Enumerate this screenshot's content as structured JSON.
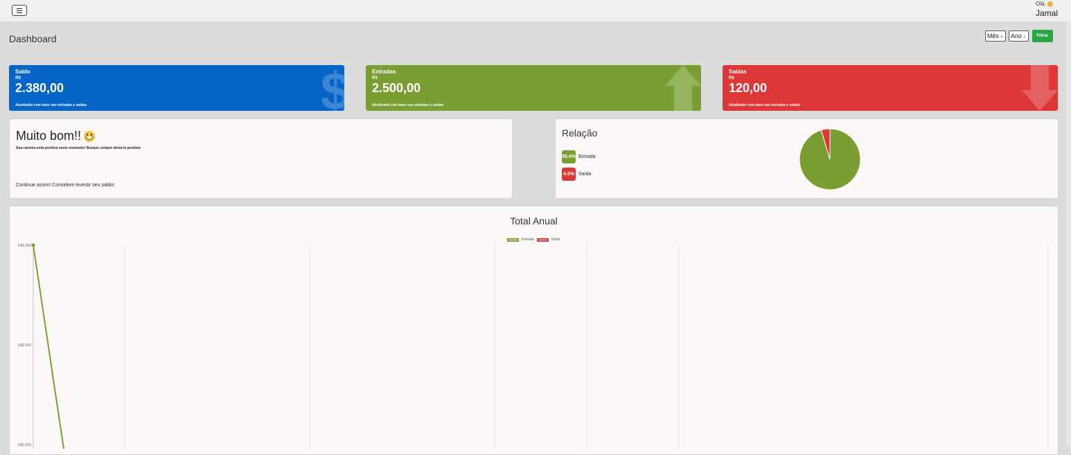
{
  "header": {
    "greeting": "Olá,",
    "user_name": "Jamal"
  },
  "page": {
    "title": "Dashboard"
  },
  "filters": {
    "month_label": "Mês",
    "year_label": "Ano",
    "filter_button": "Filtrar"
  },
  "stats": [
    {
      "label": "Saldo",
      "currency": "R$",
      "value": "2.380,00",
      "note": "Atualizado com base nas entradas e saídas",
      "color": "#0565c7",
      "icon": "dollar-icon"
    },
    {
      "label": "Entradas",
      "currency": "R$",
      "value": "2.500,00",
      "note": "Atualizado com base nas entradas e saídas",
      "color": "#7a9e31",
      "icon": "arrow-up-icon"
    },
    {
      "label": "Saídas",
      "currency": "R$",
      "value": "120,00",
      "note": "Atualizado com base nas entradas e saídas",
      "color": "#dd3737",
      "icon": "arrow-down-icon"
    }
  ],
  "message": {
    "title": "Muito bom!!",
    "subtitle": "Sua carteira está positiva neste momento! Busque sempre deixa-la positiva",
    "footer": "Continue assim! Considere investir seu saldo!"
  },
  "relation": {
    "title": "Relação",
    "items": [
      {
        "percent": "95.4%",
        "label": "Entrada",
        "color": "#7a9e31"
      },
      {
        "percent": "4.6%",
        "label": "Saída",
        "color": "#dd3737"
      }
    ]
  },
  "chart_data": [
    {
      "type": "pie",
      "title": "",
      "categories": [
        "Entrada",
        "Saída"
      ],
      "values": [
        95.4,
        4.6
      ],
      "colors": [
        "#7a9e31",
        "#dd3737"
      ]
    },
    {
      "type": "line",
      "title": "Total Anual",
      "series": [
        {
          "name": "Entrada",
          "color": "#7a9e31"
        },
        {
          "name": "Saída",
          "color": "#dd3737"
        }
      ],
      "ytick_labels": [
        "R$2.500",
        "R$2.000",
        "R$1.500"
      ]
    }
  ]
}
